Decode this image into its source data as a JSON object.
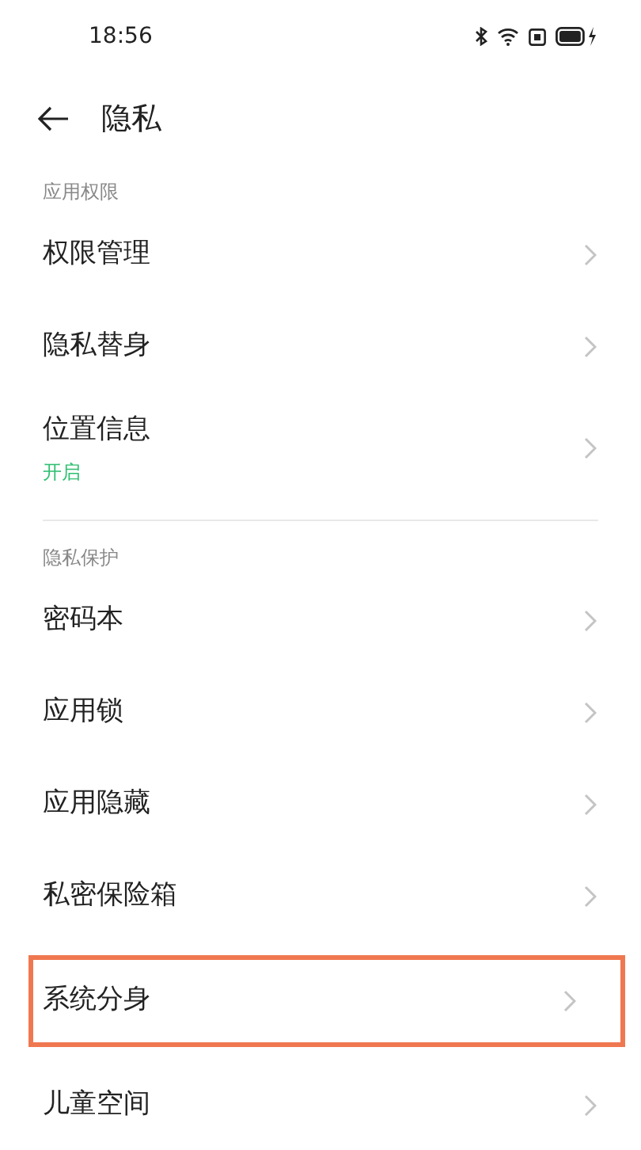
{
  "status_bar": {
    "time": "18:56"
  },
  "header": {
    "title": "隐私"
  },
  "sections": [
    {
      "title": "应用权限",
      "items": [
        {
          "label": "权限管理",
          "highlighted": false
        },
        {
          "label": "隐私替身",
          "highlighted": false
        },
        {
          "label": "位置信息",
          "status": "开启",
          "highlighted": false
        }
      ]
    },
    {
      "title": "隐私保护",
      "items": [
        {
          "label": "密码本",
          "highlighted": false
        },
        {
          "label": "应用锁",
          "highlighted": false
        },
        {
          "label": "应用隐藏",
          "highlighted": false
        },
        {
          "label": "私密保险箱",
          "highlighted": false
        },
        {
          "label": "系统分身",
          "highlighted": true
        },
        {
          "label": "儿童空间",
          "highlighted": false
        }
      ]
    }
  ]
}
